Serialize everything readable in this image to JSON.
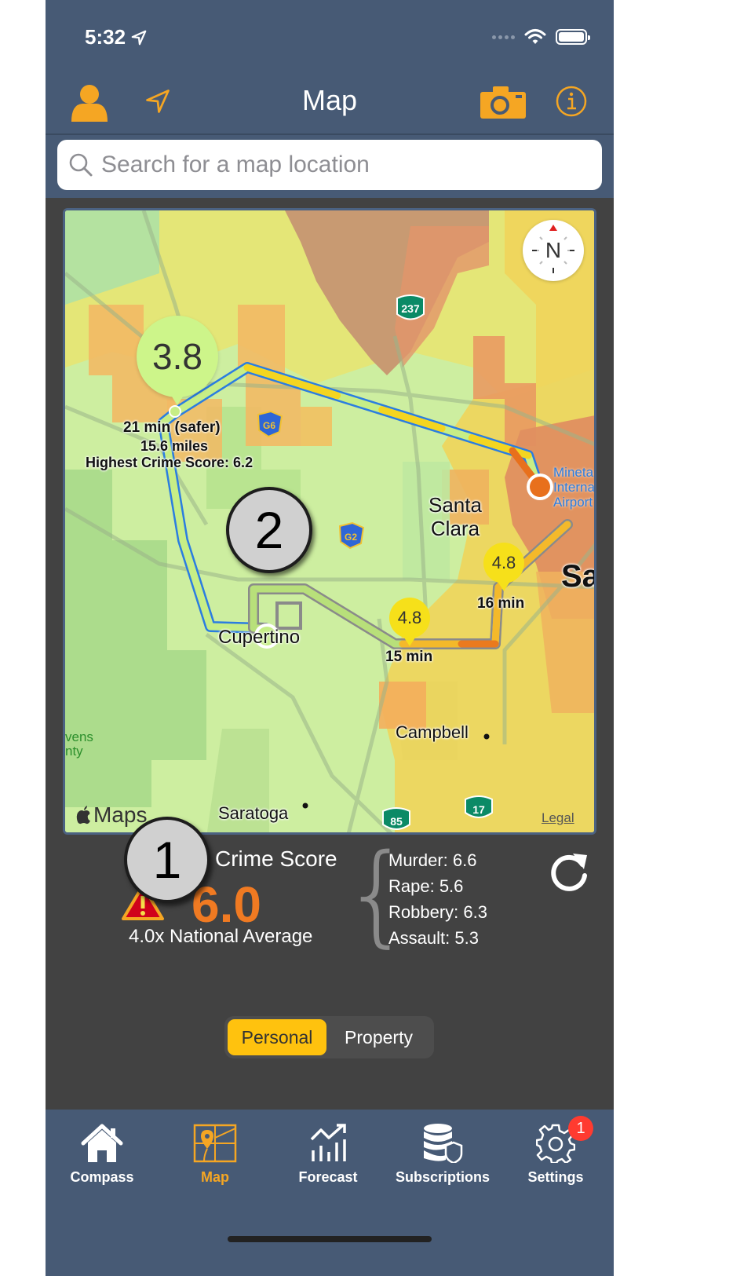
{
  "status_bar": {
    "time": "5:32"
  },
  "navbar": {
    "title": "Map"
  },
  "search": {
    "placeholder": "Search for a map location",
    "value": ""
  },
  "colors": {
    "accent": "#f5a623",
    "header_bg": "#475a75",
    "panel_bg": "#424242",
    "score_color": "#f07a22",
    "segment_active": "#ffc20e"
  },
  "map": {
    "attribution": "Maps",
    "legal_link": "Legal",
    "compass_label": "N",
    "place_labels": {
      "santa_clara_1": "Santa",
      "santa_clara_2": "Clara",
      "cupertino": "Cupertino",
      "campbell": "Campbell",
      "saratoga": "Saratoga",
      "airport_1": "Mineta",
      "airport_2": "International",
      "airport_3": "Airport",
      "san_jose_partial": "Sa",
      "stevens_1": "vens",
      "stevens_2": "nty"
    },
    "highway_shields": [
      "237",
      "G6",
      "G2",
      "85",
      "17"
    ],
    "routes": [
      {
        "score": "3.8",
        "time": "21 min (safer)",
        "distance": "15.6 miles",
        "highest": "Highest Crime Score: 6.2"
      },
      {
        "score": "4.8",
        "time": "16 min"
      },
      {
        "score": "4.8",
        "time": "15 min"
      }
    ]
  },
  "annotations": {
    "marker_1": "1",
    "marker_2": "2"
  },
  "crime_score": {
    "title": "Crime Score",
    "value": "6.0",
    "comparison": "4.0x National Average",
    "breakdown": [
      {
        "label": "Murder: 6.6"
      },
      {
        "label": "Rape: 5.6"
      },
      {
        "label": "Robbery: 6.3"
      },
      {
        "label": "Assault: 5.3"
      }
    ]
  },
  "segmented": {
    "options": [
      "Personal",
      "Property"
    ],
    "selected": "Personal"
  },
  "tabbar": {
    "items": [
      {
        "label": "Compass",
        "icon": "house-icon"
      },
      {
        "label": "Map",
        "icon": "map-pin-icon",
        "active": true
      },
      {
        "label": "Forecast",
        "icon": "trend-chart-icon"
      },
      {
        "label": "Subscriptions",
        "icon": "database-shield-icon"
      },
      {
        "label": "Settings",
        "icon": "gear-icon",
        "badge": "1"
      }
    ]
  }
}
